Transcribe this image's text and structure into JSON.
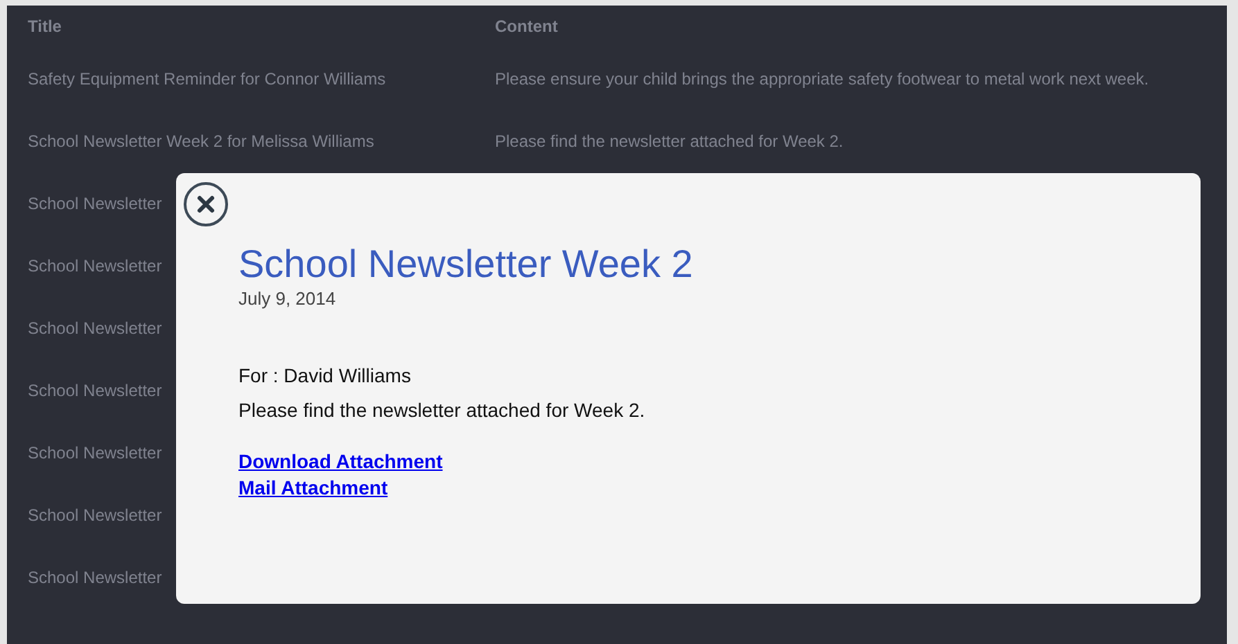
{
  "table": {
    "columns": [
      "Title",
      "Content"
    ],
    "rows": [
      [
        "Safety Equipment Reminder for Connor Williams",
        "Please ensure your child brings the appropriate safety footwear to metal work next week."
      ],
      [
        "School Newsletter Week 2 for Melissa Williams",
        "Please find the newsletter attached for Week 2."
      ],
      [
        "School Newsletter"
      ],
      [
        "School Newsletter"
      ],
      [
        "School Newsletter"
      ],
      [
        "School Newsletter"
      ],
      [
        "School Newsletter"
      ],
      [
        "School Newsletter"
      ],
      [
        "School Newsletter"
      ]
    ]
  },
  "modal": {
    "title": "School Newsletter Week 2",
    "date": "July 9, 2014",
    "recipient": "For : David Williams",
    "message": "Please find the newsletter attached for Week 2.",
    "links": [
      "Download Attachment",
      "Mail Attachment"
    ]
  }
}
